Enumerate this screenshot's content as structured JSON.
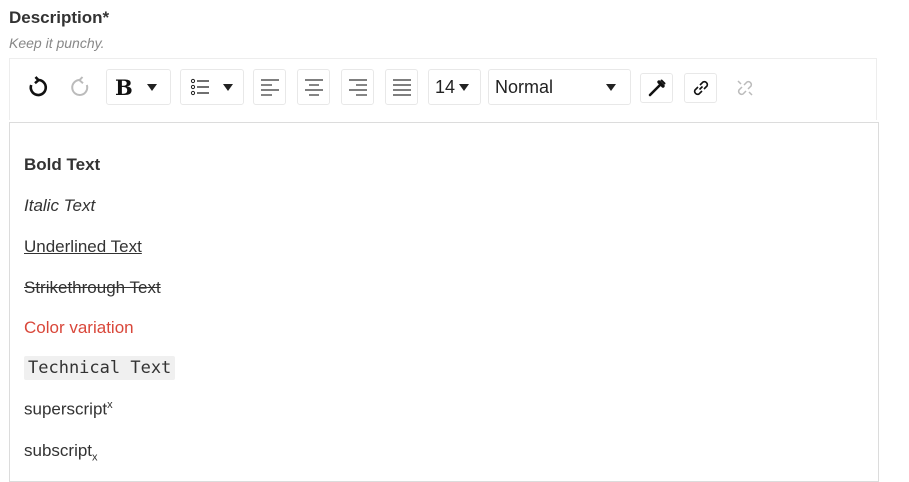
{
  "field": {
    "label": "Description*",
    "hint": "Keep it punchy."
  },
  "toolbar": {
    "font_size": "14",
    "block_style": "Normal",
    "bold_glyph": "B"
  },
  "content": {
    "bold": "Bold Text",
    "italic": "Italic Text",
    "underline": "Underlined Text",
    "strike": "Strikethrough Text",
    "color_text": "Color variation",
    "color_value": "#d9473a",
    "technical": "Technical Text",
    "superscript_base": "superscript",
    "superscript_mark": "x",
    "subscript_base": "subscript",
    "subscript_mark": "x"
  }
}
